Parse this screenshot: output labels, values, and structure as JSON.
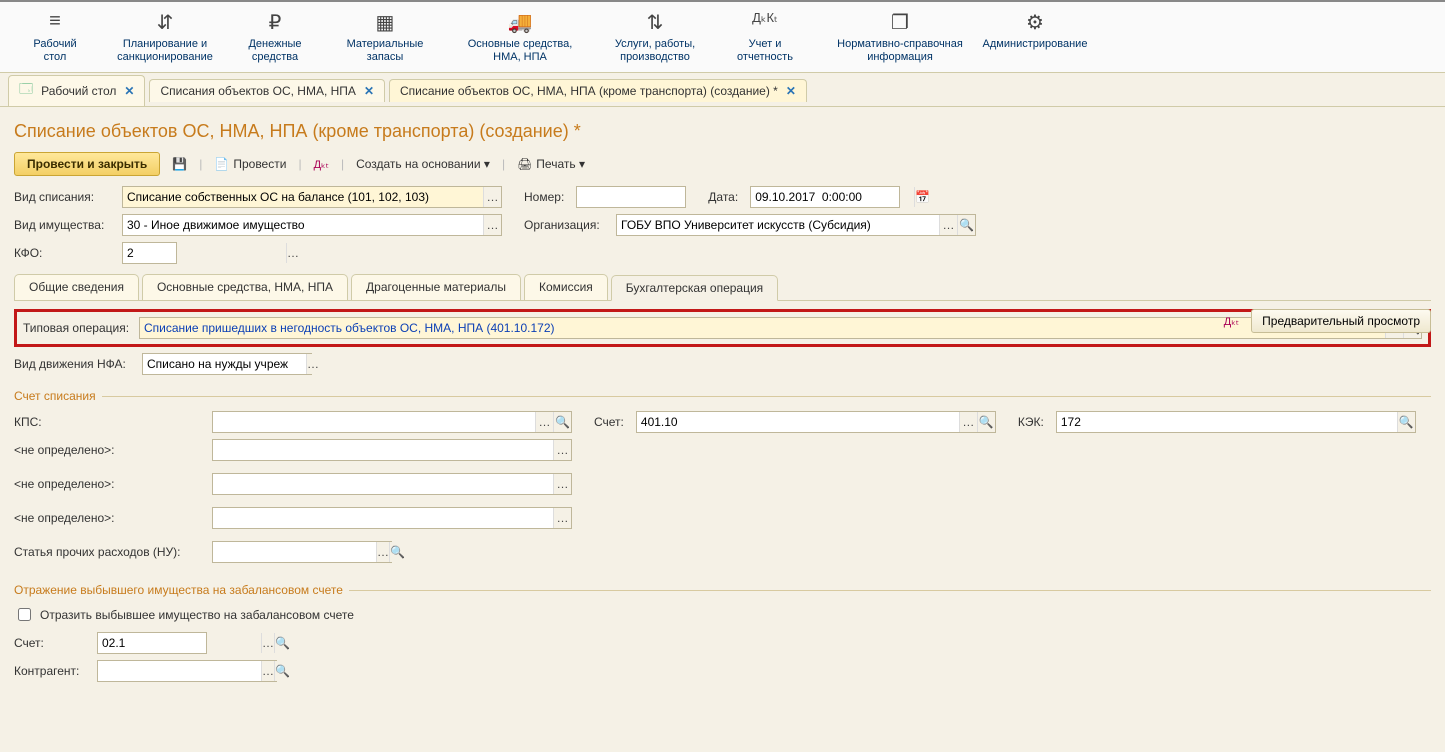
{
  "nav": [
    {
      "label": "Рабочий\nстол",
      "icon": "≡"
    },
    {
      "label": "Планирование и\nсанкционирование",
      "icon": "⇵"
    },
    {
      "label": "Денежные\nсредства",
      "icon": "₽"
    },
    {
      "label": "Материальные\nзапасы",
      "icon": "▦"
    },
    {
      "label": "Основные средства,\nНМА, НПА",
      "icon": "🚚"
    },
    {
      "label": "Услуги, работы,\nпроизводство",
      "icon": "⇅"
    },
    {
      "label": "Учет и\nотчетность",
      "icon": "ДₖКₜ"
    },
    {
      "label": "Нормативно-справочная\nинформация",
      "icon": "❐"
    },
    {
      "label": "Администрирование",
      "icon": "⚙"
    }
  ],
  "tabs": [
    {
      "label": "Рабочий стол"
    },
    {
      "label": "Списания объектов ОС, НМА, НПА"
    },
    {
      "label": "Списание объектов ОС, НМА, НПА (кроме транспорта) (создание) *",
      "active": true
    }
  ],
  "page_title": "Списание объектов ОС, НМА, НПА (кроме транспорта) (создание) *",
  "toolbar": {
    "primary": "Провести и закрыть",
    "provesti": "Провести",
    "create_based": "Создать на основании ▾",
    "print": "Печать ▾"
  },
  "fields": {
    "vid_spisaniya_label": "Вид списания:",
    "vid_spisaniya_value": "Списание собственных ОС на балансе (101, 102, 103)",
    "nomer_label": "Номер:",
    "nomer_value": "",
    "data_label": "Дата:",
    "data_value": "09.10.2017  0:00:00",
    "vid_im_label": "Вид имущества:",
    "vid_im_value": "30 - Иное движимое имущество",
    "org_label": "Организация:",
    "org_value": "ГОБУ ВПО Университет искусств (Субсидия)",
    "kfo_label": "КФО:",
    "kfo_value": "2"
  },
  "subtabs": [
    "Общие сведения",
    "Основные средства, НМА, НПА",
    "Драгоценные материалы",
    "Комиссия",
    "Бухгалтерская операция"
  ],
  "subtab_active": 4,
  "typ_op_label": "Типовая операция:",
  "typ_op_value": "Списание пришедших в негодность объектов ОС, НМА, НПА (401.10.172)",
  "preview_btn": "Предварительный просмотр",
  "vid_dvizh_label": "Вид движения НФА:",
  "vid_dvizh_value": "Списано на нужды учреж",
  "group1_title": "Счет списания",
  "kps_label": "КПС:",
  "schet_label": "Счет:",
  "schet_value": "401.10",
  "kek_label": "КЭК:",
  "kek_value": "172",
  "nd": "<не определено>:",
  "stat_label": "Статья прочих расходов (НУ):",
  "group2_title": "Отражение выбывшего имущества на забалансовом счете",
  "chk_label": "Отразить выбывшее имущество на забалансовом счете",
  "schet2_label": "Счет:",
  "schet2_value": "02.1",
  "kontr_label": "Контрагент:"
}
